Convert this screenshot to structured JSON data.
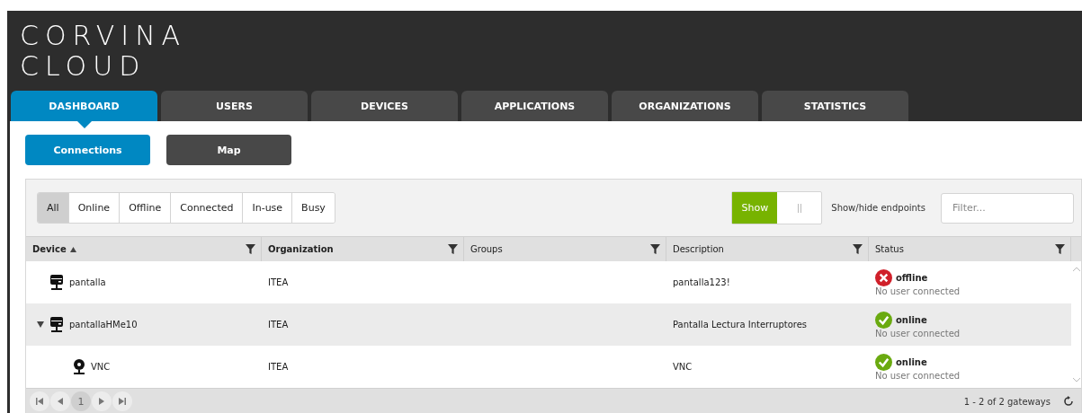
{
  "logo": {
    "lines": [
      "CORVINA",
      "CLOUD"
    ]
  },
  "tabs": [
    {
      "label": "DASHBOARD",
      "selected": true
    },
    {
      "label": "USERS",
      "selected": false
    },
    {
      "label": "DEVICES",
      "selected": false
    },
    {
      "label": "APPLICATIONS",
      "selected": false
    },
    {
      "label": "ORGANIZATIONS",
      "selected": false
    },
    {
      "label": "STATISTICS",
      "selected": false
    }
  ],
  "subtabs": [
    {
      "label": "Connections",
      "selected": true
    },
    {
      "label": "Map",
      "selected": false
    }
  ],
  "filters": [
    {
      "label": "All",
      "selected": true
    },
    {
      "label": "Online",
      "selected": false
    },
    {
      "label": "Offline",
      "selected": false
    },
    {
      "label": "Connected",
      "selected": false
    },
    {
      "label": "In-use",
      "selected": false
    },
    {
      "label": "Busy",
      "selected": false
    }
  ],
  "endpoints_toggle": {
    "label": "Show",
    "on": true,
    "caption": "Show/hide endpoints"
  },
  "search": {
    "placeholder": "Filter..."
  },
  "table": {
    "columns": [
      {
        "label": "Device",
        "bold": true,
        "sorted": true
      },
      {
        "label": "Organization",
        "bold": true,
        "sorted": false
      },
      {
        "label": "Groups",
        "bold": false,
        "sorted": false
      },
      {
        "label": "Description",
        "bold": false,
        "sorted": false
      },
      {
        "label": "Status",
        "bold": false,
        "sorted": false
      }
    ],
    "rows": [
      {
        "kind": "gateway",
        "device": "pantalla",
        "organization": "ITEA",
        "description": "pantalla123!",
        "status": {
          "kind": "offline",
          "label": "offline",
          "detail": "No user connected"
        }
      },
      {
        "kind": "gateway",
        "device": "pantallaHMe10",
        "expanded": true,
        "organization": "ITEA",
        "description": "Pantalla Lectura Interruptores",
        "status": {
          "kind": "online",
          "label": "online",
          "detail": "No user connected"
        },
        "children": [
          {
            "kind": "endpoint",
            "device": "VNC",
            "organization": "ITEA",
            "description": "VNC",
            "status": {
              "kind": "online",
              "label": "online",
              "detail": "No user connected"
            }
          }
        ]
      }
    ]
  },
  "pager": {
    "page": "1",
    "summary": "1 - 2 of 2 gateways"
  }
}
